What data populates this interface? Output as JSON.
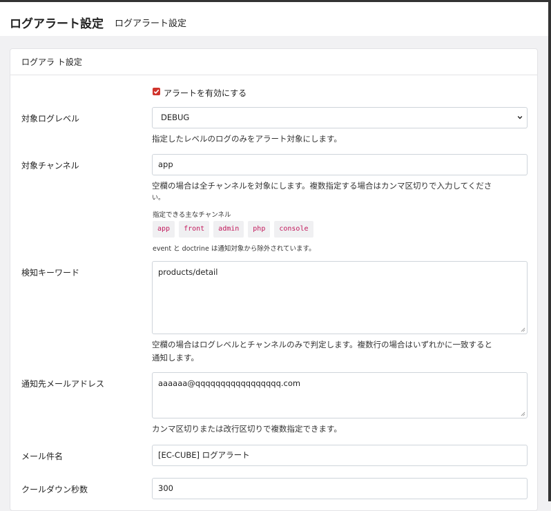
{
  "header": {
    "title": "ログアラート設定",
    "subtitle": "ログアラート設定"
  },
  "card": {
    "title": "ログアラ ト設定"
  },
  "form": {
    "enable_label": "アラートを有効にする",
    "enable_checked": true,
    "level": {
      "label": "対象ログレベル",
      "value": "DEBUG",
      "help": "指定したレベルのログのみをアラート対象にします。"
    },
    "channel": {
      "label": "対象チャンネル",
      "value": "app",
      "help_line1": "空欄の場合は全チャンネルを対象にします。複数指定する場合はカンマ区切りで入力してくださ",
      "help_line2": "い。",
      "available_label": "指定できる主なチャンネル",
      "chips": [
        "app",
        "front",
        "admin",
        "php",
        "console"
      ],
      "excluded_note": "event と doctrine は通知対象から除外されています。"
    },
    "keywords": {
      "label": "検知キーワード",
      "value": "products/detail",
      "help_line1": "空欄の場合はログレベルとチャンネルのみで判定します。複数行の場合はいずれかに一致すると",
      "help_line2": "通知します。"
    },
    "email": {
      "label": "通知先メールアドレス",
      "value": "aaaaaa@qqqqqqqqqqqqqqqqq.com",
      "help": "カンマ区切りまたは改行区切りで複数指定できます。"
    },
    "subject": {
      "label": "メール件名",
      "value": "[EC-CUBE] ログアラート"
    },
    "cooldown": {
      "label": "クールダウン秒数",
      "value": "300"
    }
  },
  "colors": {
    "accent": "#d0342c",
    "chip_text": "#c2185b",
    "page_bg": "#f1f1f3"
  }
}
